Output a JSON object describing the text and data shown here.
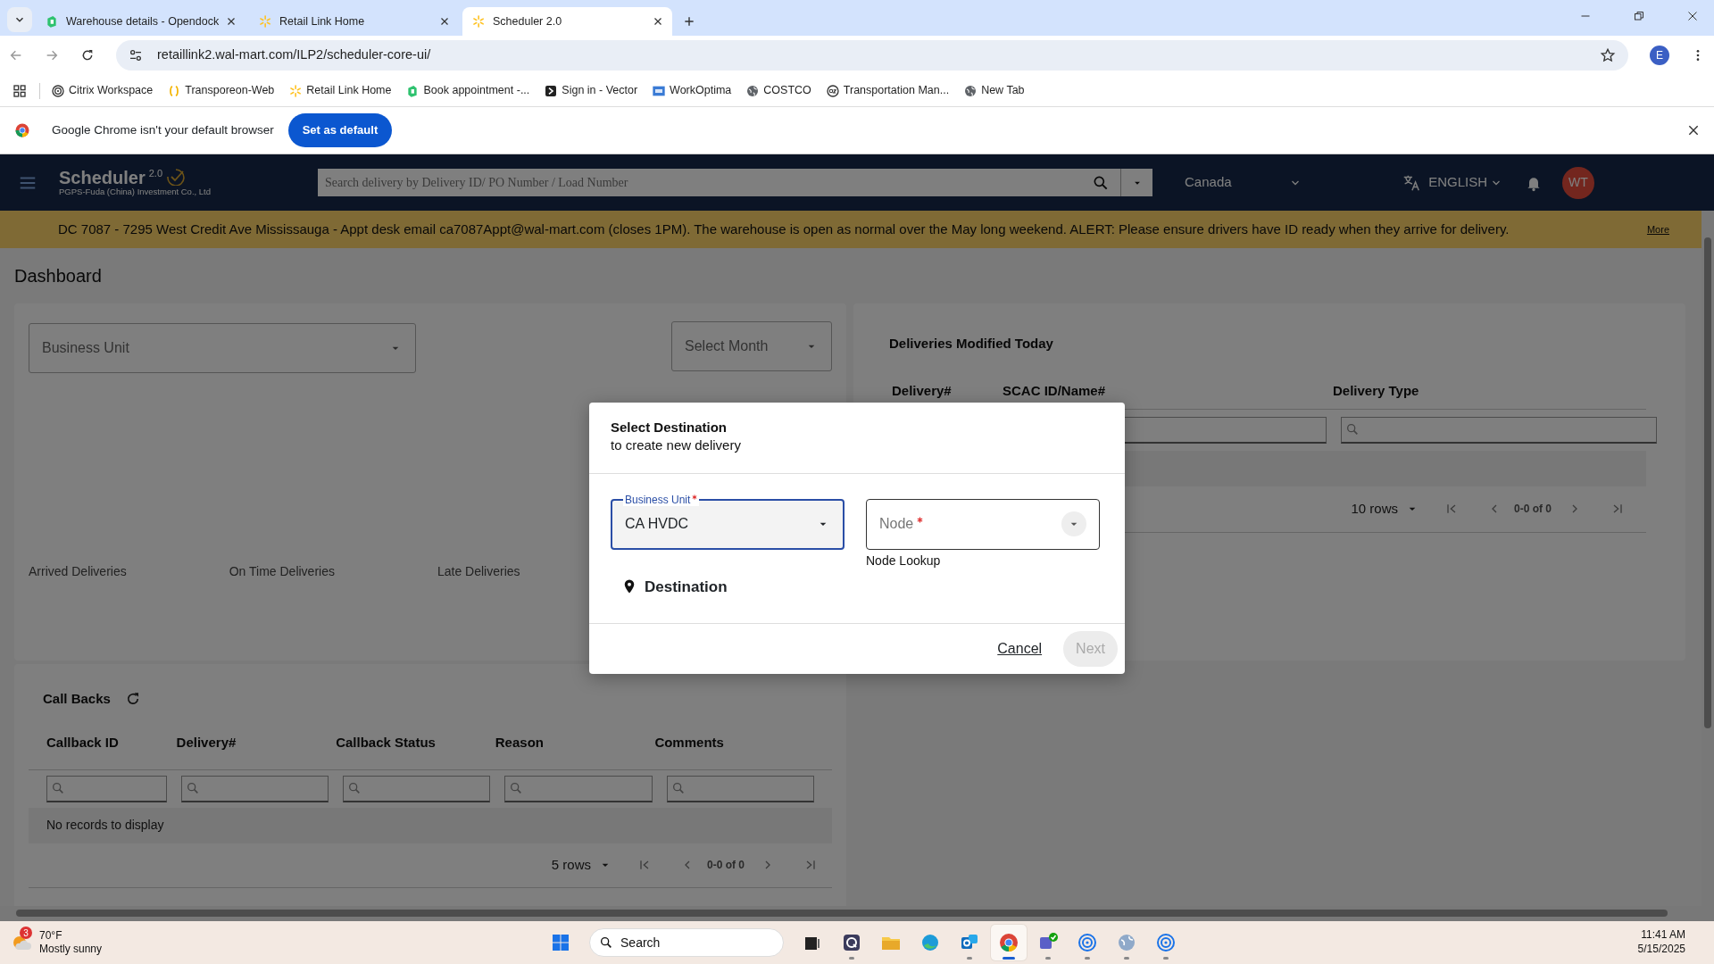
{
  "browser": {
    "tabs": [
      {
        "title": "Warehouse details - Opendock",
        "selected": false,
        "kind": "opendock"
      },
      {
        "title": "Retail Link Home",
        "selected": false,
        "kind": "spark"
      },
      {
        "title": "Scheduler 2.0",
        "selected": true,
        "kind": "spark"
      }
    ],
    "url": "retaillink2.wal-mart.com/ILP2/scheduler-core-ui/",
    "profile": "E",
    "bookmarks": [
      {
        "title": "Citrix Workspace",
        "kind": "spiral"
      },
      {
        "title": "Transporeon-Web",
        "kind": "brackets"
      },
      {
        "title": "Retail Link Home",
        "kind": "spark"
      },
      {
        "title": "Book appointment -...",
        "kind": "opendock"
      },
      {
        "title": "Sign in - Vector",
        "kind": "vector"
      },
      {
        "title": "WorkOptima",
        "kind": "wo"
      },
      {
        "title": "COSTCO",
        "kind": "globe"
      },
      {
        "title": "Transportation Man...",
        "kind": "e2"
      },
      {
        "title": "New Tab",
        "kind": "globe"
      }
    ],
    "infobar": {
      "text": "Google Chrome isn't your default browser",
      "button": "Set as default"
    }
  },
  "app": {
    "title": "Scheduler",
    "version": "2.0",
    "company": "PGPS-Fuda (China) Investment Co., Ltd",
    "search_placeholder": "Search delivery by Delivery ID/ PO Number / Load Number",
    "country": "Canada",
    "language": "ENGLISH",
    "avatar": "WT"
  },
  "banner": {
    "text": "DC 7087 - 7295 West Credit Ave Mississauga - Appt desk email ca7087Appt@wal-mart.com (closes 1PM). The warehouse is open as normal over the May long weekend. ALERT: Please ensure drivers have ID ready when they arrive for delivery.",
    "more": "More"
  },
  "dashboard": {
    "title": "Dashboard",
    "business_unit_placeholder": "Business Unit",
    "month_placeholder": "Select Month",
    "stats": [
      "Arrived Deliveries",
      "On Time Deliveries",
      "Late Deliveries"
    ]
  },
  "modified": {
    "title": "Deliveries Modified Today",
    "columns": [
      "Delivery#",
      "SCAC ID/Name#",
      "Delivery Type"
    ],
    "rows_per_page": "10 rows",
    "range": "0-0 of 0"
  },
  "callbacks": {
    "title": "Call Backs",
    "columns": [
      "Callback ID",
      "Delivery#",
      "Callback Status",
      "Reason",
      "Comments"
    ],
    "empty": "No records to display",
    "rows_per_page": "5 rows",
    "range": "0-0 of 0"
  },
  "modal": {
    "title": "Select Destination",
    "subtitle": "to create new delivery",
    "business_unit_label": "Business Unit",
    "business_unit_value": "CA HVDC",
    "node_placeholder": "Node",
    "node_helper": "Node Lookup",
    "destination": "Destination",
    "cancel": "Cancel",
    "next": "Next",
    "next_disabled": true
  },
  "taskbar": {
    "weather_badge": "3",
    "temperature": "70°F",
    "weather": "Mostly sunny",
    "search": "Search",
    "time": "11:41 AM",
    "date": "5/15/2025",
    "apps": [
      {
        "kind": "start",
        "selected": false,
        "running": false
      },
      {
        "kind": "taskview",
        "selected": false,
        "running": false
      },
      {
        "kind": "qapp",
        "selected": false,
        "running": true
      },
      {
        "kind": "files",
        "selected": false,
        "running": false
      },
      {
        "kind": "edge",
        "selected": false,
        "running": false
      },
      {
        "kind": "outlook",
        "selected": false,
        "running": true
      },
      {
        "kind": "chrome",
        "selected": true,
        "running": true
      },
      {
        "kind": "teams",
        "selected": false,
        "running": true
      },
      {
        "kind": "spiral",
        "selected": false,
        "running": true
      },
      {
        "kind": "globe",
        "selected": false,
        "running": true
      },
      {
        "kind": "spiral",
        "selected": false,
        "running": true
      }
    ]
  }
}
